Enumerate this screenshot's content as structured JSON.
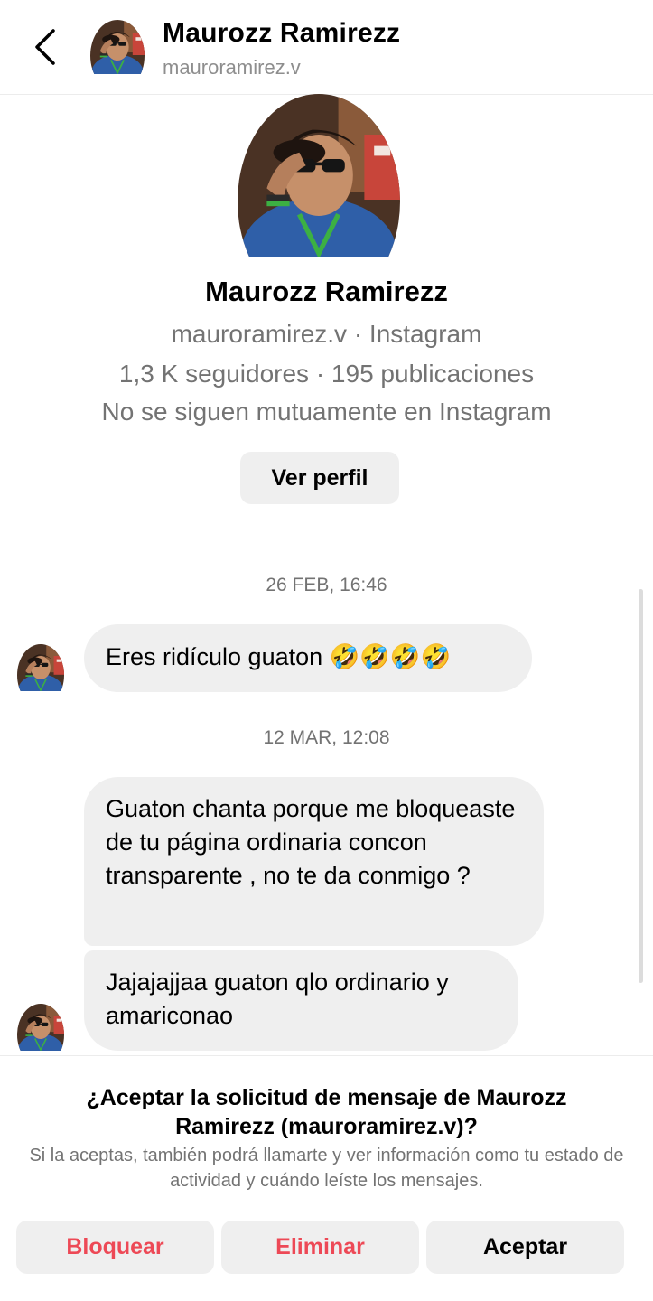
{
  "header": {
    "back_icon": "chevron-left-icon",
    "name": "Maurozz Ramirezz",
    "username": "mauroramirez.v"
  },
  "profile": {
    "name": "Maurozz Ramirezz",
    "subtitle": "mauroramirez.v · Instagram",
    "stats": "1,3 K seguidores · 195 publicaciones",
    "relation": "No se siguen mutuamente en Instagram",
    "view_profile_label": "Ver perfil"
  },
  "chat": {
    "timestamp_1": "26 FEB, 16:46",
    "message_1": "Eres ridículo guaton 🤣🤣🤣🤣",
    "timestamp_2": "12 MAR, 12:08",
    "message_2": "Guaton chanta porque me bloqueaste de tu página ordinaria concon transparente , no te da conmigo ?",
    "message_3": "Jajajajjaa guaton qlo ordinario y amariconao"
  },
  "request": {
    "title": "¿Aceptar la solicitud de mensaje de Maurozz Ramirezz (mauroramirez.v)?",
    "description": "Si la aceptas, también podrá llamarte y ver información como tu estado de actividad y cuándo leíste los mensajes.",
    "block_label": "Bloquear",
    "delete_label": "Eliminar",
    "accept_label": "Aceptar"
  },
  "colors": {
    "danger": "#ed4956",
    "bubble": "#efefef",
    "secondary_text": "#737373"
  }
}
